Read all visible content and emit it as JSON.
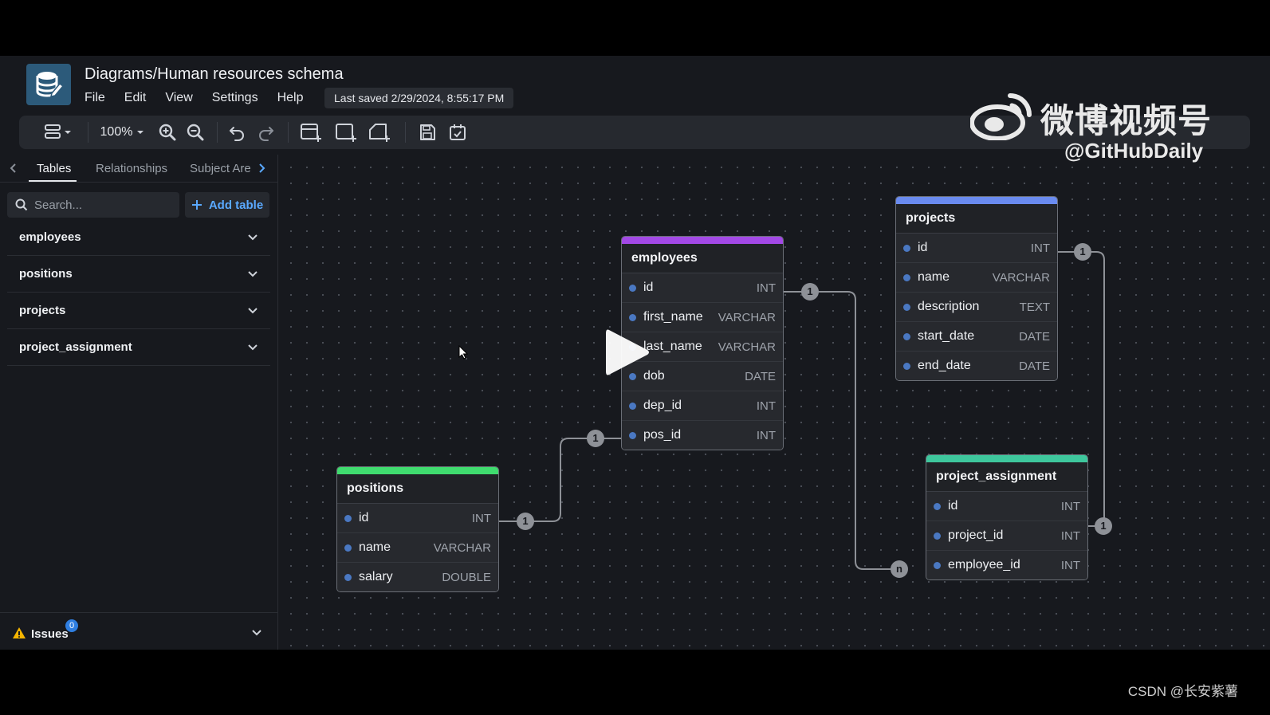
{
  "header": {
    "title": "Diagrams/Human resources schema",
    "menu": [
      "File",
      "Edit",
      "View",
      "Settings",
      "Help"
    ],
    "last_saved": "Last saved 2/29/2024, 8:55:17 PM"
  },
  "toolbar": {
    "zoom": "100%",
    "icons": [
      "layout-menu-icon",
      "zoom-in-icon",
      "zoom-out-icon",
      "undo-icon",
      "redo-icon",
      "add-table-icon",
      "add-area-icon",
      "add-note-icon",
      "save-icon",
      "todo-icon"
    ]
  },
  "sidebar": {
    "tabs": [
      "Tables",
      "Relationships",
      "Subject Are"
    ],
    "active_tab": "Tables",
    "search_placeholder": "Search...",
    "add_table": "Add table",
    "tables": [
      "employees",
      "positions",
      "projects",
      "project_assignment"
    ],
    "issues_label": "Issues",
    "issues_count": "0"
  },
  "diagram": {
    "tables": [
      {
        "name": "employees",
        "color": "#a349e6",
        "fields": [
          {
            "name": "id",
            "type": "INT"
          },
          {
            "name": "first_name",
            "type": "VARCHAR"
          },
          {
            "name": "last_name",
            "type": "VARCHAR"
          },
          {
            "name": "dob",
            "type": "DATE"
          },
          {
            "name": "dep_id",
            "type": "INT"
          },
          {
            "name": "pos_id",
            "type": "INT"
          }
        ]
      },
      {
        "name": "projects",
        "color": "#6a8bf0",
        "fields": [
          {
            "name": "id",
            "type": "INT"
          },
          {
            "name": "name",
            "type": "VARCHAR"
          },
          {
            "name": "description",
            "type": "TEXT"
          },
          {
            "name": "start_date",
            "type": "DATE"
          },
          {
            "name": "end_date",
            "type": "DATE"
          }
        ]
      },
      {
        "name": "positions",
        "color": "#3fdc6e",
        "fields": [
          {
            "name": "id",
            "type": "INT"
          },
          {
            "name": "name",
            "type": "VARCHAR"
          },
          {
            "name": "salary",
            "type": "DOUBLE"
          }
        ]
      },
      {
        "name": "project_assignment",
        "color": "#3ec79d",
        "fields": [
          {
            "name": "id",
            "type": "INT"
          },
          {
            "name": "project_id",
            "type": "INT"
          },
          {
            "name": "employee_id",
            "type": "INT"
          }
        ]
      }
    ],
    "cardinality": {
      "one": "1",
      "many": "n"
    }
  },
  "watermarks": {
    "weibo_text": "微博视频号",
    "weibo_handle": "@GitHubDaily",
    "csdn": "CSDN @长安紫薯"
  }
}
